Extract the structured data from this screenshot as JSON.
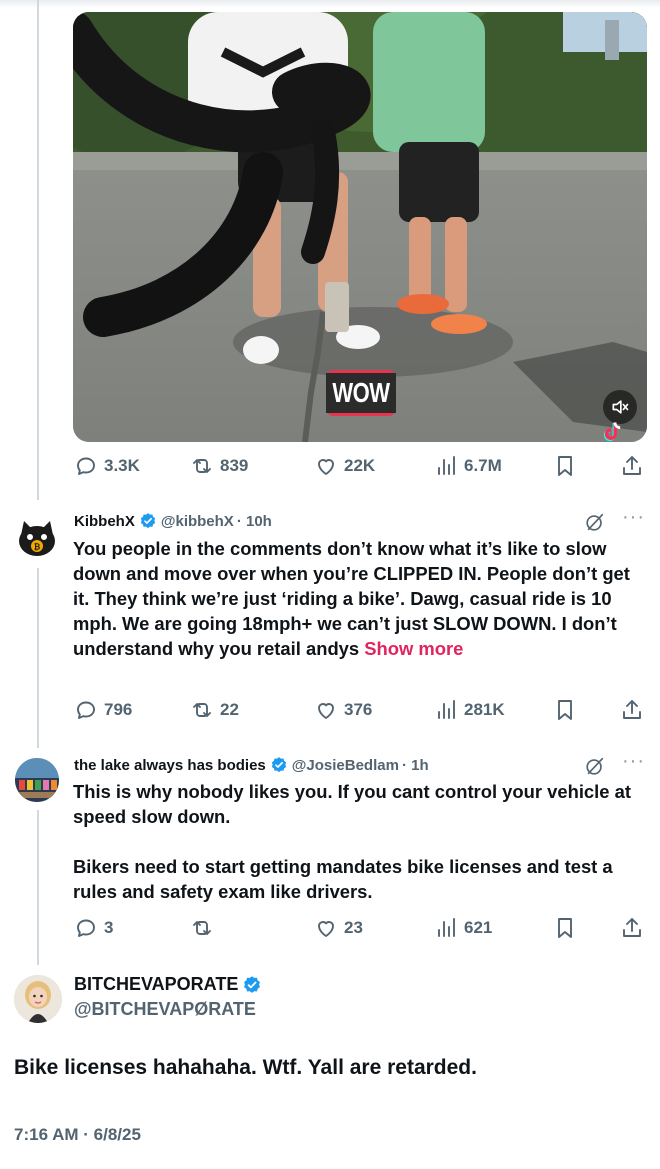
{
  "media": {
    "caption_badge": "WOW",
    "mute_icon": "mute-speaker-icon",
    "watermark_icon": "tiktok-icon"
  },
  "post_actions": {
    "replies": "3.3K",
    "reposts": "839",
    "likes": "22K",
    "views": "6.7M"
  },
  "replies": [
    {
      "name": "KibbehX",
      "handle": "@kibbehX",
      "time": "· 10h",
      "text": "You people in the comments don’t know what it’s like to slow down and move over when you’re CLIPPED IN. People don’t get it. They think we’re just ‘riding a bike’. Dawg, casual ride is 10 mph. We are going 18mph+ we can’t just SLOW DOWN. I don’t understand why you retail andys",
      "show_more": "Show more",
      "replies": "796",
      "reposts": "22",
      "likes": "376",
      "views": "281K"
    },
    {
      "name": "the lake always has bodies",
      "handle": "@JosieBedlam",
      "time": "· 1h",
      "text_p1": "This is why nobody likes you. If you cant control your vehicle at speed slow down.",
      "text_p2": "Bikers need to start getting mandates bike licenses and test a rules and safety exam like drivers.",
      "replies": "3",
      "reposts": "",
      "likes": "23",
      "views": "621"
    }
  ],
  "main_post": {
    "name": "BITCHEVAPORATE",
    "handle": "@BITCHEVAPØRATE",
    "text": "Bike licenses hahahaha. Wtf. Yall are retarded.",
    "timestamp": "7:16 AM · 6/8/25"
  },
  "colors": {
    "verified": "#1d9bf0",
    "muted_text": "#536471",
    "show_more": "#e0245e",
    "thread_line": "#cfd9de"
  }
}
